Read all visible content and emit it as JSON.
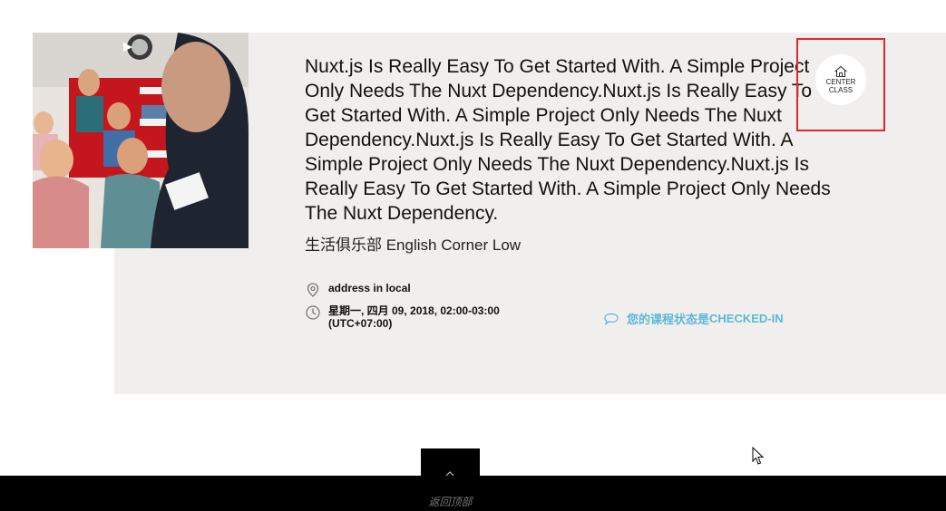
{
  "event": {
    "title": "Nuxt.js Is Really Easy To Get Started With. A Simple Project Only Needs The Nuxt Dependency.Nuxt.js Is Really Easy To Get Started With. A Simple Project Only Needs The Nuxt Dependency.Nuxt.js Is Really Easy To Get Started With. A Simple Project Only Needs The Nuxt Dependency.Nuxt.js Is Really Easy To Get Started With. A Simple Project Only Needs The Nuxt Dependency.",
    "subtitle": "生活俱乐部 English Corner Low",
    "address": "address in local",
    "datetime": "星期一, 四月 09, 2018, 02:00-03:00",
    "timezone": "(UTC+07:00)",
    "status_prefix": "您的课程状态是",
    "status_value": "CHECKED-IN",
    "badge_line1": "CENTER",
    "badge_line2": "CLASS"
  },
  "icons": {
    "address": "location-pin-icon",
    "time": "clock-icon",
    "status": "chat-bubble-icon",
    "badge": "house-icon",
    "back_to_top": "chevron-up-icon"
  },
  "footer": {
    "back_to_top_label": "返回顶部"
  },
  "colors": {
    "card_bg": "#f1efee",
    "status": "#5bb8d6",
    "highlight": "#e0282e",
    "footer": "#000000"
  }
}
